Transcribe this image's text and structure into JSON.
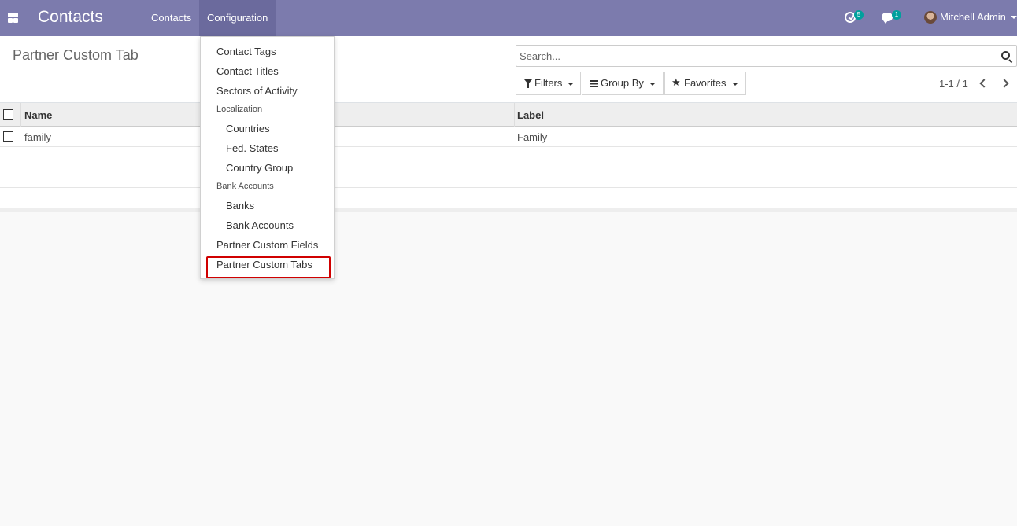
{
  "navbar": {
    "app_title": "Contacts",
    "menus": [
      "Contacts",
      "Configuration"
    ],
    "activity_count": "5",
    "message_count": "1",
    "user_name": "Mitchell Admin"
  },
  "control_panel": {
    "breadcrumb": "Partner Custom Tab",
    "search_placeholder": "Search...",
    "filters_label": "Filters",
    "groupby_label": "Group By",
    "favorites_label": "Favorites",
    "pager": "1-1 / 1"
  },
  "list": {
    "columns": [
      "Name",
      "Label"
    ],
    "rows": [
      {
        "name": "family",
        "label": "Family"
      }
    ]
  },
  "dropdown": {
    "items": [
      "Contact Tags",
      "Contact Titles",
      "Sectors of Activity",
      "Localization",
      "Countries",
      "Fed. States",
      "Country Group",
      "Bank Accounts",
      "Banks",
      "Bank Accounts",
      "Partner Custom Fields",
      "Partner Custom Tabs"
    ]
  },
  "colors": {
    "navbar": "#7c7bad",
    "badge": "#00a09d",
    "highlight": "#d00000"
  }
}
